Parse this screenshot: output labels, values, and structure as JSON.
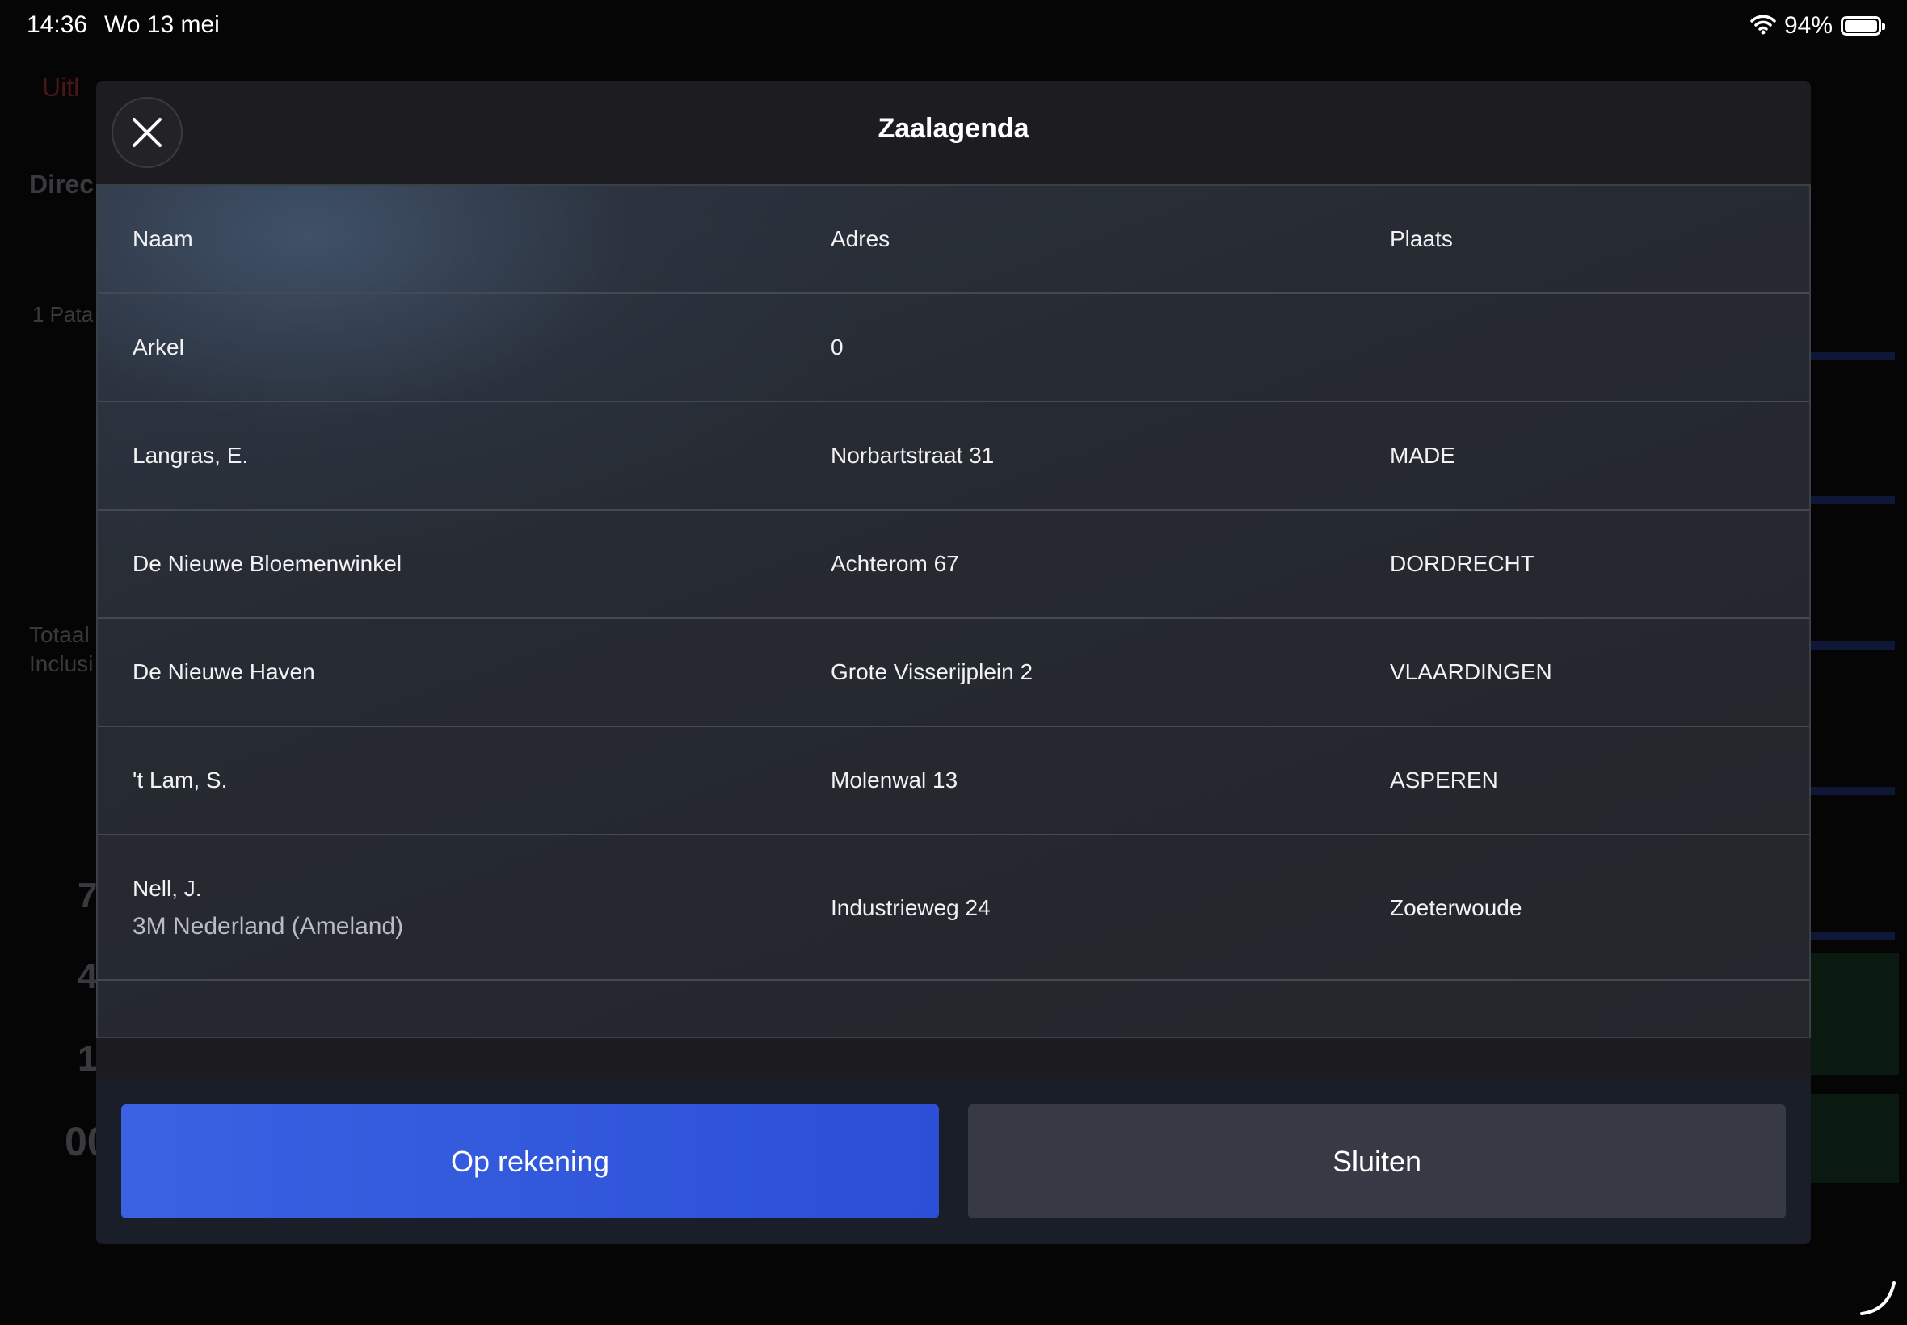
{
  "status_bar": {
    "time": "14:36",
    "date": "Wo 13 mei",
    "battery_pct": "94%"
  },
  "background_app": {
    "top_left_label": "Uitl",
    "section_label": "Direc",
    "row_label": "1  Pata",
    "total_label": "Totaal",
    "incl_label": "Inclusi",
    "digit_a": "7",
    "digit_b": "4",
    "digit_c": "1",
    "digit_d": "00"
  },
  "modal": {
    "title": "Zaalagenda",
    "table": {
      "headers": [
        "Naam",
        "Adres",
        "Plaats"
      ],
      "rows": [
        {
          "name": "Arkel",
          "address": "0",
          "place": ""
        },
        {
          "name": "Langras, E.",
          "address": "Norbartstraat 31",
          "place": "MADE"
        },
        {
          "name": "De Nieuwe Bloemenwinkel",
          "address": "Achterom 67",
          "place": "DORDRECHT"
        },
        {
          "name": "De Nieuwe Haven",
          "address": "Grote Visserijplein 2",
          "place": "VLAARDINGEN"
        },
        {
          "name": "'t Lam, S.",
          "address": "Molenwal 13",
          "place": "ASPEREN"
        },
        {
          "name": "Nell, J.",
          "subname": "3M Nederland (Ameland)",
          "address": "Industrieweg 24",
          "place": "Zoeterwoude"
        }
      ]
    },
    "buttons": {
      "primary": "Op rekening",
      "secondary": "Sluiten"
    }
  },
  "colors": {
    "primary_button": "#3a62e2",
    "secondary_button": "#373a45",
    "modal_bg": "#1c1c20"
  }
}
